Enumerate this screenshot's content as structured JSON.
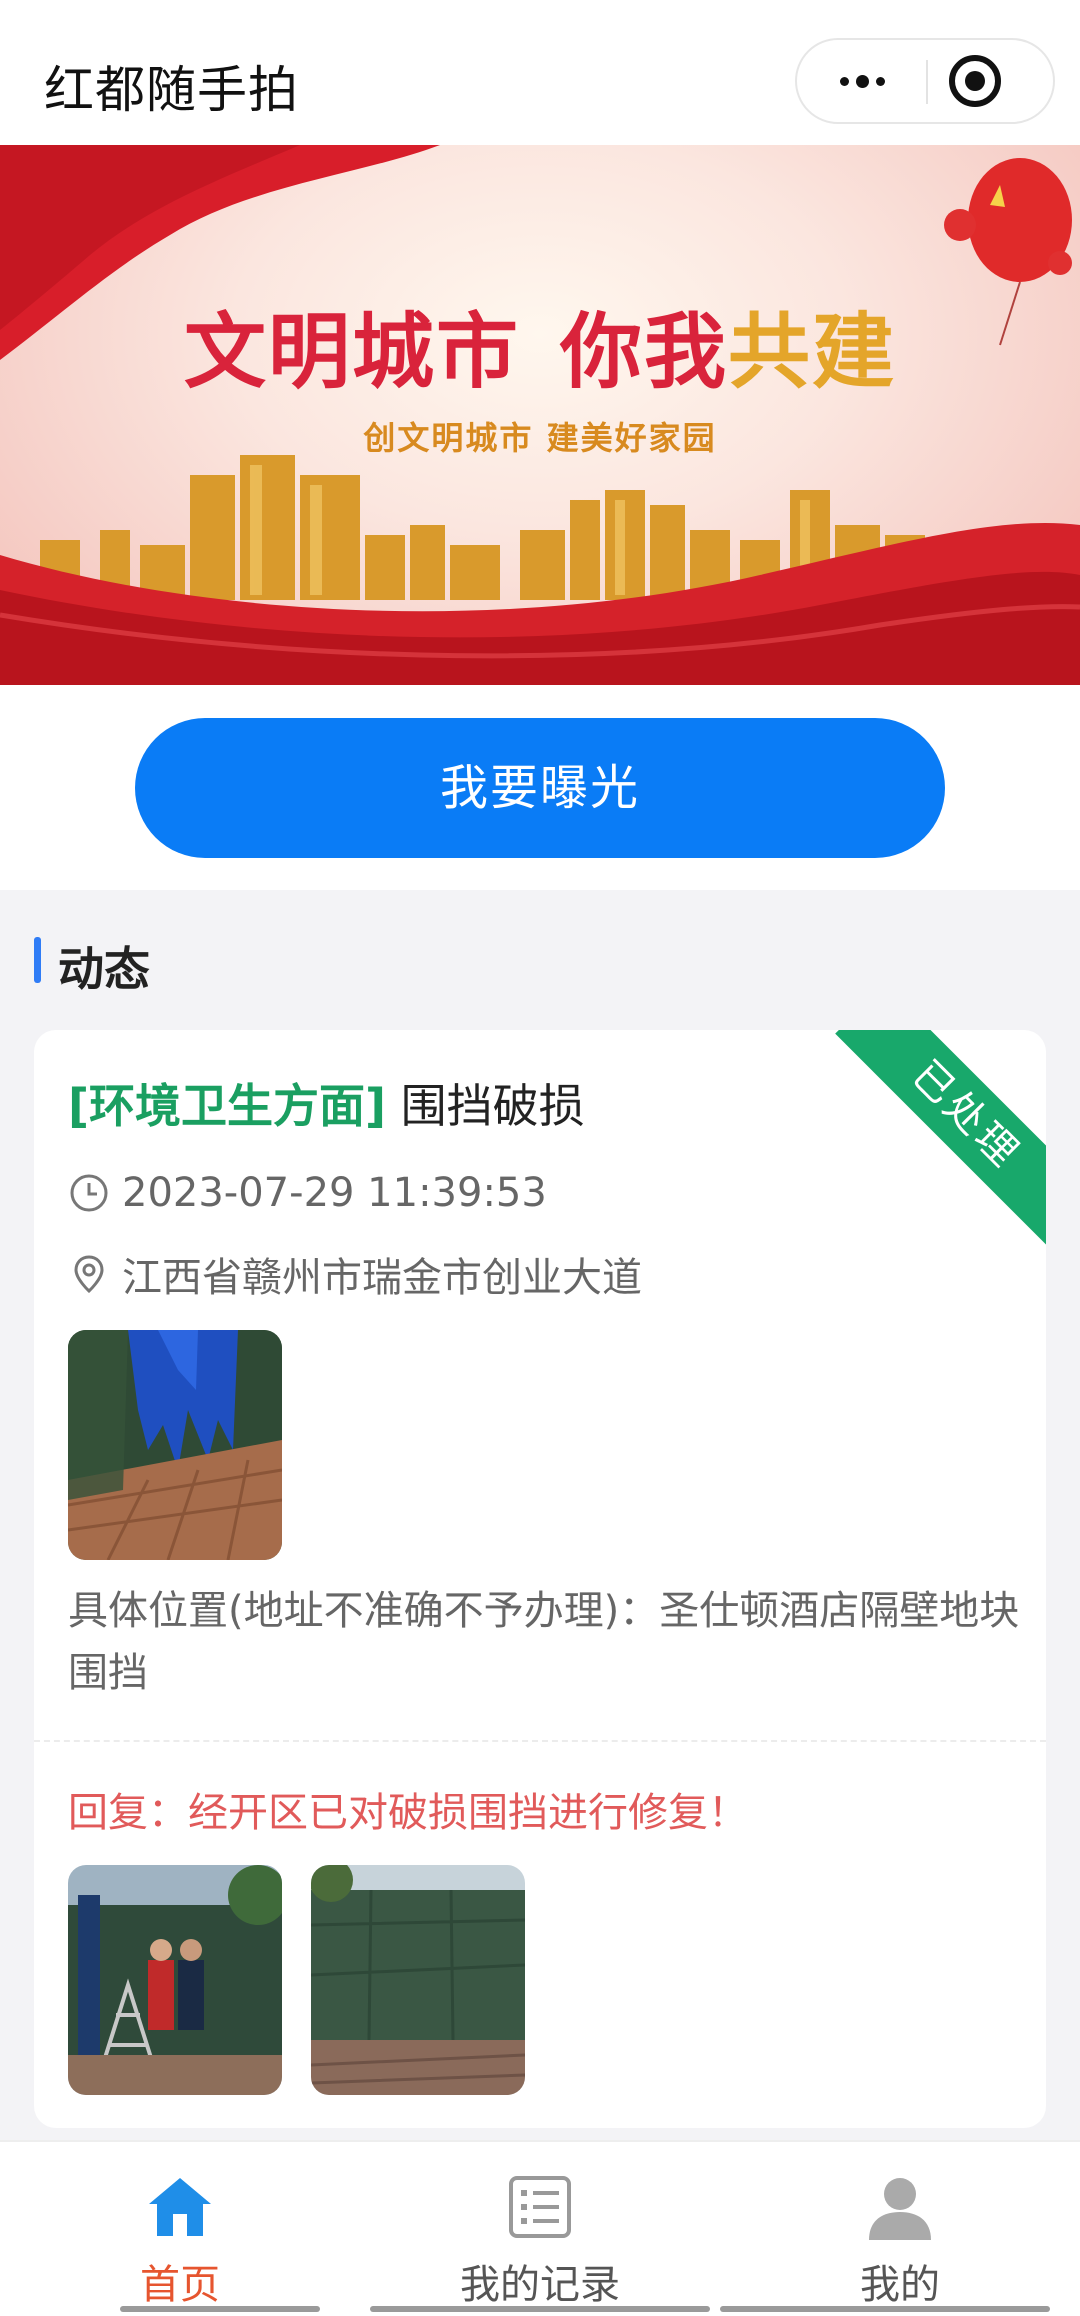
{
  "header": {
    "title": "红都随手拍",
    "more_icon": "more-dots-icon",
    "close_icon": "mini-program-close-icon"
  },
  "banner": {
    "headline_part1": "文明城市",
    "headline_part2a": "你我",
    "headline_part2b": "共建",
    "subtitle": "创文明城市  建美好家园"
  },
  "actions": {
    "expose_label": "我要曝光"
  },
  "feed": {
    "section_title": "动态",
    "posts": [
      {
        "category": "[环境卫生方面]",
        "title": "围挡破损",
        "status": "已处理",
        "time": "2023-07-29 11:39:53",
        "location": "江西省赣州市瑞金市创业大道",
        "description": "具体位置(地址不准确不予办理)：圣仕顿酒店隔壁地块围挡",
        "reply": "回复：经开区已对破损围挡进行修复！"
      }
    ]
  },
  "tabbar": {
    "tabs": [
      {
        "label": "首页",
        "icon": "home-icon",
        "active": true
      },
      {
        "label": "我的记录",
        "icon": "list-icon",
        "active": false
      },
      {
        "label": "我的",
        "icon": "user-icon",
        "active": false
      }
    ]
  },
  "colors": {
    "primary": "#0a7cf6",
    "category": "#1a9f61",
    "status_ribbon": "#18a86b",
    "reply": "#e15a5a",
    "active_tab": "#e6552f"
  }
}
